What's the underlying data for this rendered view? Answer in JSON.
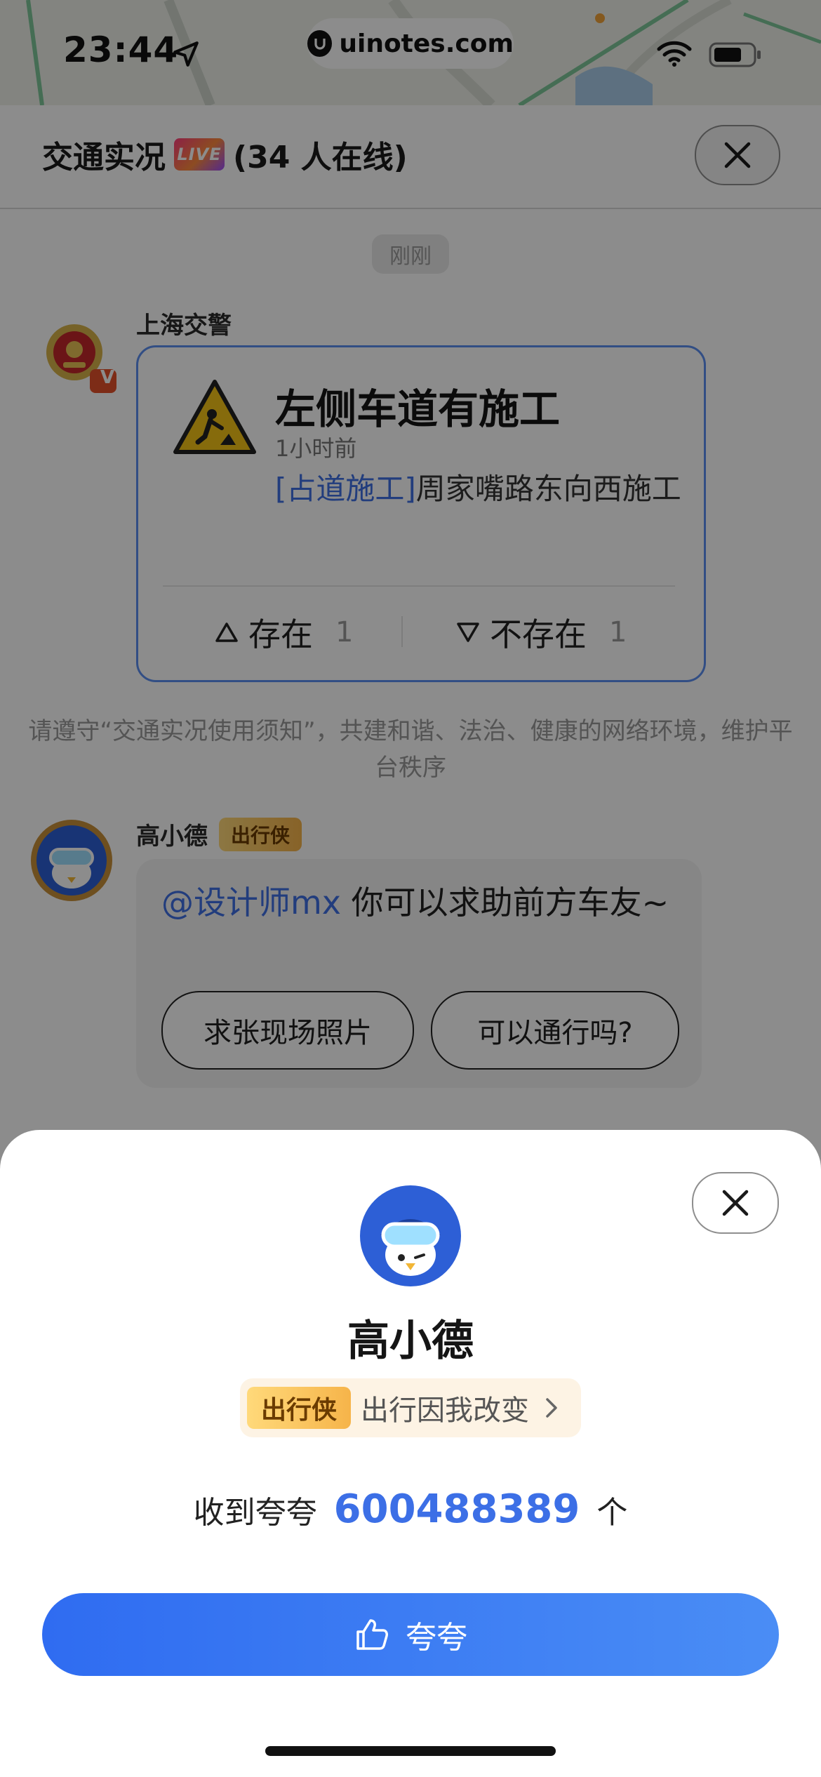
{
  "status_bar": {
    "time": "23:44",
    "watermark": "uinotes.com"
  },
  "header": {
    "title": "交通实况",
    "live_badge": "LIVE",
    "online_text": "(34 人在线)"
  },
  "chat": {
    "time_chip": "刚刚",
    "message1": {
      "sender": "上海交警",
      "verified_badge": "V",
      "title": "左侧车道有施工",
      "time_ago": "1小时前",
      "tag": "[占道施工]",
      "body": "周家嘴路东向西施工",
      "vote_exist_label": "存在",
      "vote_exist_count": "1",
      "vote_not_exist_label": "不存在",
      "vote_not_exist_count": "1"
    },
    "notice": "请遵守“交通实况使用须知”，共建和谐、法治、健康的网络环境，维护平台秩序",
    "message2": {
      "sender": "高小德",
      "badge": "出行侠",
      "mention": "@设计师mx",
      "text": " 你可以求助前方车友~",
      "quick_reply_1": "求张现场照片",
      "quick_reply_2": "可以通行吗?"
    }
  },
  "sheet": {
    "name": "高小德",
    "badge": "出行侠",
    "slogan": "出行因我改变",
    "praise_prefix": "收到夸夸",
    "praise_count": "600488389",
    "praise_suffix": "个",
    "praise_button": "夸夸"
  },
  "colors": {
    "accent_blue": "#3c6fe6",
    "live_gradient": "#ff3d7f",
    "hero_badge": "#f6b44a",
    "card_border": "#5b8ff0"
  },
  "icons": [
    "location-arrow-icon",
    "wifi-icon",
    "battery-icon",
    "close-icon",
    "warning-construction-icon",
    "triangle-up-icon",
    "triangle-down-icon",
    "chevron-right-icon",
    "thumbs-up-icon"
  ]
}
